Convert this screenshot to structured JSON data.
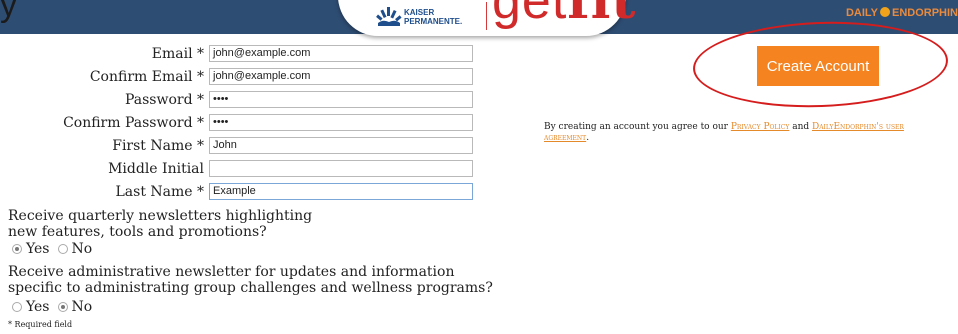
{
  "header": {
    "partial_left_text": "y",
    "partner_name_line1": "KAISER",
    "partner_name_line2": "PERMANENTE.",
    "app_logo_prefix": "get",
    "app_logo_suffix": "fit",
    "brand_left": "DAILY",
    "brand_right": "ENDORPHIN"
  },
  "form": {
    "fields": [
      {
        "label": "Email *",
        "value": "john@example.com"
      },
      {
        "label": "Confirm Email *",
        "value": "john@example.com"
      },
      {
        "label": "Password *",
        "value": "••••"
      },
      {
        "label": "Confirm Password *",
        "value": "••••"
      },
      {
        "label": "First Name *",
        "value": "John"
      },
      {
        "label": "Middle Initial",
        "value": ""
      },
      {
        "label": "Last Name *",
        "value": "Example"
      }
    ],
    "newsletter_q1_line1": "Receive quarterly newsletters highlighting",
    "newsletter_q1_line2": "new features, tools and promotions?",
    "q1_yes": "Yes",
    "q1_no": "No",
    "newsletter_q2_line1": "Receive administrative newsletter for updates and information",
    "newsletter_q2_line2": "specific to administrating group challenges and wellness programs?",
    "q2_yes": "Yes",
    "q2_no": "No",
    "required_note": "* Required field"
  },
  "actions": {
    "create_account": "Create Account"
  },
  "agreement": {
    "prefix": "By creating an account you agree to our ",
    "privacy_link": "Privacy Policy",
    "and": " and ",
    "user_agreement_link": "DailyEndorphin's user agreement",
    "suffix": "."
  },
  "colors": {
    "banner": "#2e4d73",
    "button": "#f5831f",
    "annotation": "#d51d1d",
    "link": "#e58a2b"
  }
}
